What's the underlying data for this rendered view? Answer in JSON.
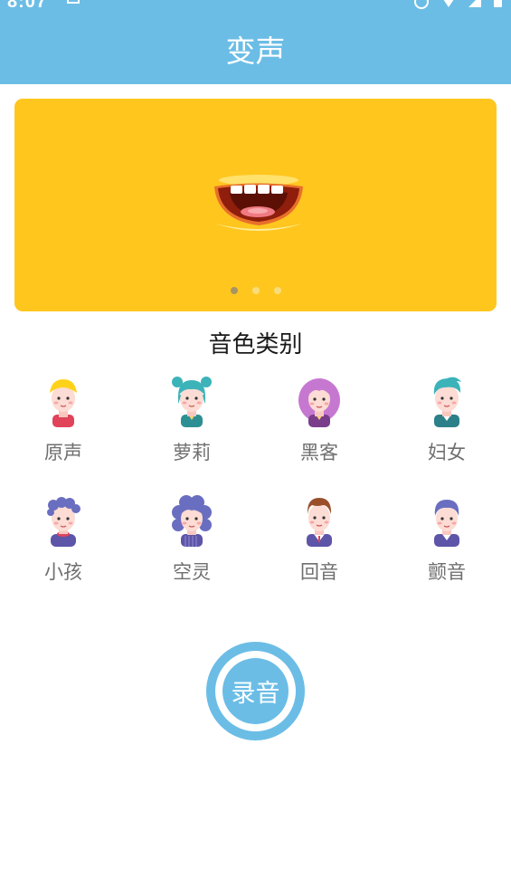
{
  "status_bar": {
    "time": "8:07",
    "icons": [
      "sd-card-icon",
      "alarm-icon",
      "wifi-icon",
      "signal-icon",
      "battery-icon"
    ]
  },
  "header": {
    "title": "变声"
  },
  "banner": {
    "image": "mouth-illustration",
    "page_count": 3,
    "active_page": 1
  },
  "section": {
    "title": "音色类别"
  },
  "voices": [
    {
      "label": "原声",
      "avatar": "boy-yellow-hair-avatar"
    },
    {
      "label": "萝莉",
      "avatar": "girl-teal-buns-avatar"
    },
    {
      "label": "黑客",
      "avatar": "woman-purple-hair-avatar"
    },
    {
      "label": "妇女",
      "avatar": "teal-hair-avatar"
    },
    {
      "label": "小孩",
      "avatar": "child-blue-curls-avatar"
    },
    {
      "label": "空灵",
      "avatar": "woman-blue-curls-avatar"
    },
    {
      "label": "回音",
      "avatar": "man-brown-hair-avatar"
    },
    {
      "label": "颤音",
      "avatar": "man-blue-hair-avatar"
    }
  ],
  "record_button": {
    "label": "录音"
  },
  "colors": {
    "primary": "#6bbde6",
    "banner": "#ffc61e",
    "label_text": "#6f6f6f"
  }
}
